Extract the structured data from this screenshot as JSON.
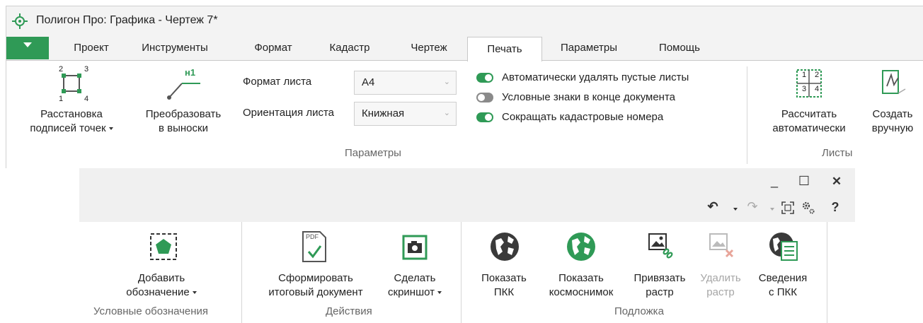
{
  "window1": {
    "title": "Полигон Про: Графика - Чертеж 7*",
    "tabs": [
      "Проект",
      "Инструменты",
      "Формат",
      "Кадастр",
      "Чертеж",
      "Печать",
      "Параметры",
      "Помощь"
    ],
    "active_tab": "Печать",
    "ribbon": {
      "point_labels_button": {
        "line1": "Расстановка",
        "line2": "подписей точек"
      },
      "convert_button": {
        "line1": "Преобразовать",
        "line2": "в выноски"
      },
      "convert_icon_text": "н1",
      "point_icon_numbers": [
        "2",
        "3",
        "1",
        "4"
      ],
      "sheet_format_label": "Формат листа",
      "sheet_format_value": "A4",
      "orientation_label": "Ориентация листа",
      "orientation_value": "Книжная",
      "toggles": [
        {
          "label": "Автоматически удалять пустые листы",
          "state": "on"
        },
        {
          "label": "Условные знаки в конце документа",
          "state": "off"
        },
        {
          "label": "Сокращать кадастровые номера",
          "state": "on"
        }
      ],
      "params_group_label": "Параметры",
      "calc_auto_button": {
        "line1": "Рассчитать",
        "line2": "автоматически"
      },
      "calc_icon_numbers": [
        "1",
        "2",
        "3",
        "4"
      ],
      "create_manual_button": {
        "line1": "Создать",
        "line2": "вручную"
      },
      "sheets_group_label": "Листы"
    }
  },
  "window2": {
    "controls": {
      "minimize": "_",
      "maximize": "☐",
      "close": "✕"
    },
    "quick_tools": {
      "undo": "↶",
      "redo": "↷",
      "help": "?"
    },
    "ribbon": {
      "add_symbol_button": {
        "line1": "Добавить",
        "line2": "обозначение"
      },
      "symbols_group_label": "Условные обозначения",
      "final_doc_button": {
        "line1": "Сформировать",
        "line2": "итоговый документ"
      },
      "pdf_icon_text": "PDF",
      "screenshot_button": {
        "line1": "Сделать",
        "line2": "скриншот"
      },
      "actions_group_label": "Действия",
      "show_pkk_button": {
        "line1": "Показать",
        "line2": "ПКК"
      },
      "show_satellite_button": {
        "line1": "Показать",
        "line2": "космоснимок"
      },
      "bind_raster_button": {
        "line1": "Привязать",
        "line2": "растр"
      },
      "delete_raster_button": {
        "line1": "Удалить",
        "line2": "растр"
      },
      "pkk_info_button": {
        "line1": "Сведения",
        "line2": "с ПКК"
      },
      "background_group_label": "Подложка"
    }
  },
  "colors": {
    "accent_green": "#2f9a56",
    "dark_icon": "#3a3a3a",
    "disabled_text": "#a6a6a6"
  }
}
